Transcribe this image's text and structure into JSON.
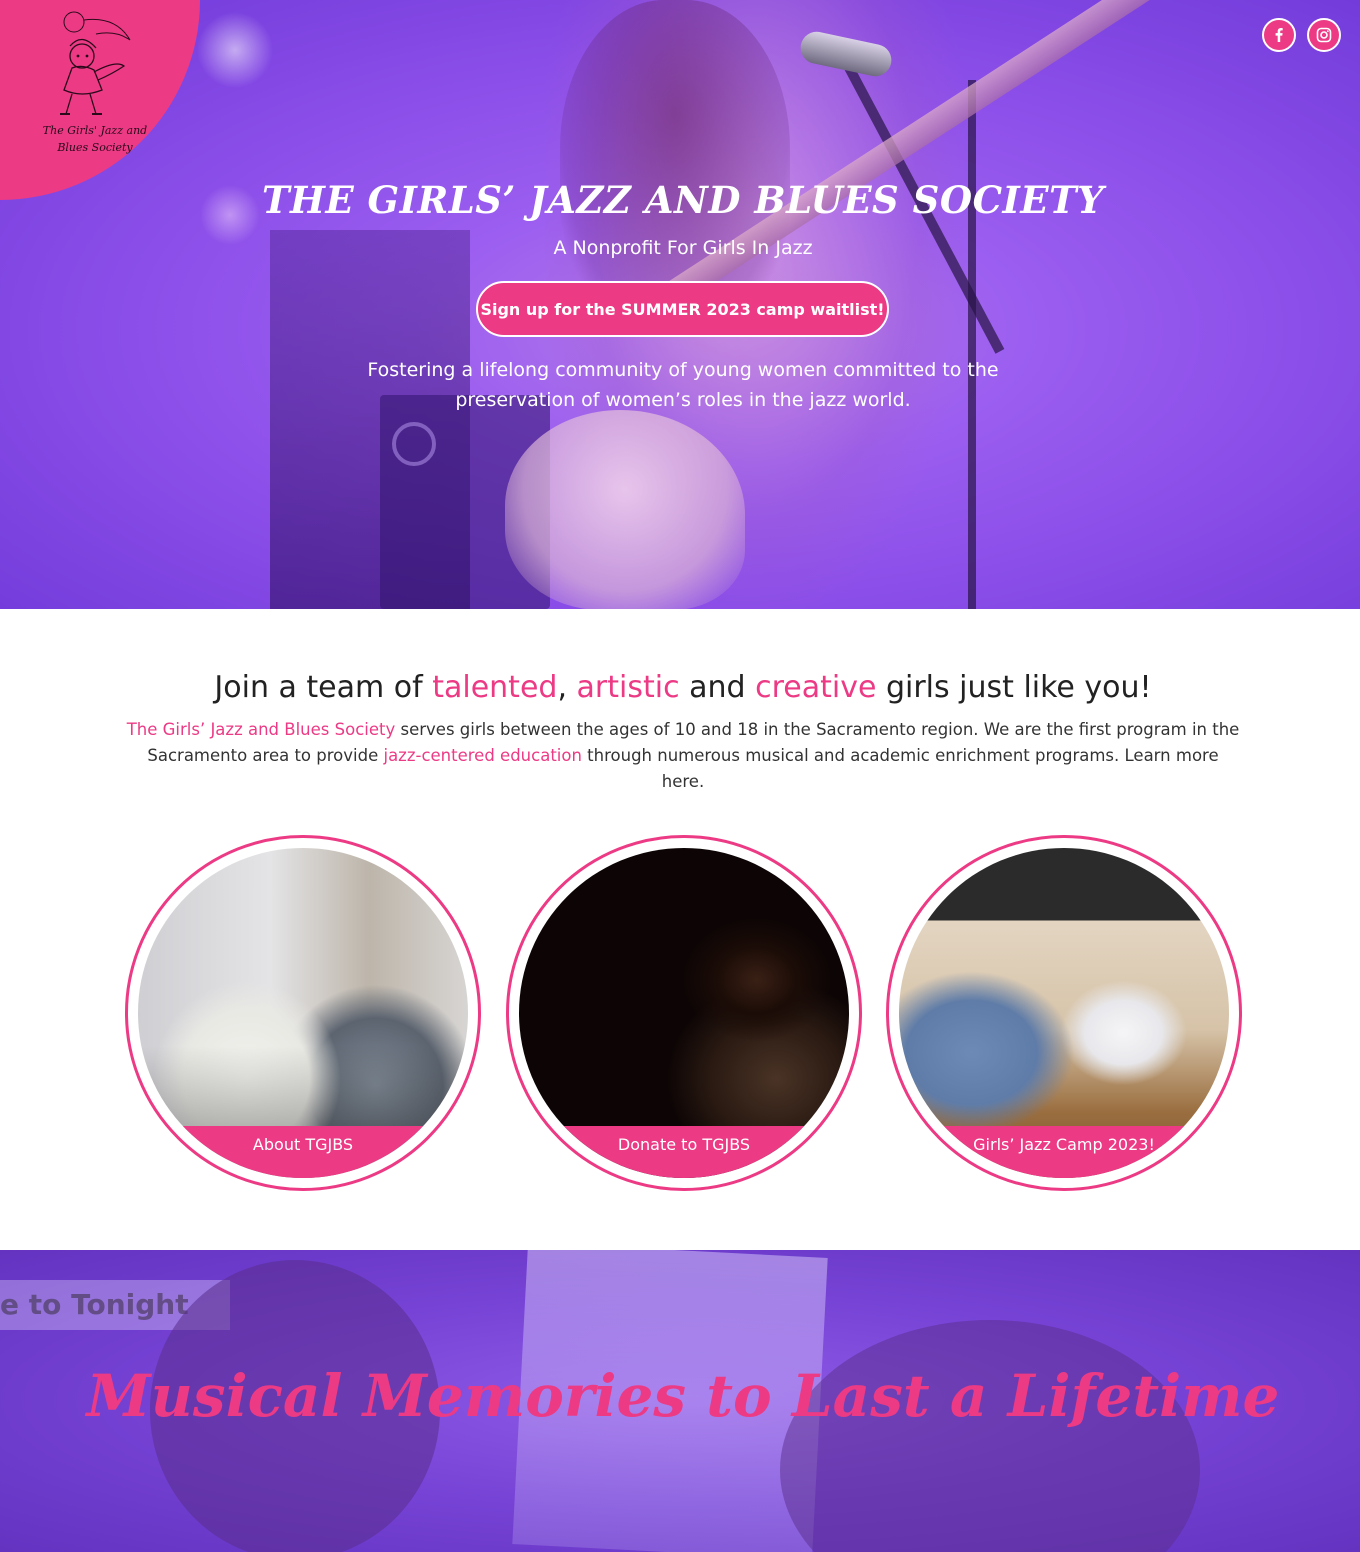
{
  "logo": {
    "text_line1": "The Girls' Jazz and",
    "text_line2": "Blues Society"
  },
  "social": {
    "facebook_icon": "facebook-icon",
    "instagram_icon": "instagram-icon"
  },
  "hero": {
    "title": "THE GIRLS’ JAZZ AND BLUES SOCIETY",
    "subtitle": "A Nonprofit For Girls In Jazz",
    "cta_label": "Sign up for the SUMMER 2023 camp waitlist!",
    "tagline": "Fostering a lifelong community of young women committed to the preservation of women’s roles in the jazz world."
  },
  "join": {
    "title_part1": "Join a team of ",
    "title_hl1": "talented",
    "title_sep1": ", ",
    "title_hl2": "artistic",
    "title_part2": " and ",
    "title_hl3": "creative",
    "title_part3": " girls just like you!",
    "body_link1": "The Girls’ Jazz and Blues Society",
    "body_part1": " serves girls between the ages of 10 and 18 in the Sacramento region. We are the first program in the Sacramento area to provide ",
    "body_link2": "jazz-centered education",
    "body_part2": " through numerous musical and academic enrichment programs. Learn more here."
  },
  "cards": [
    {
      "label": "About TGJBS"
    },
    {
      "label": "Donate to TGJBS"
    },
    {
      "label": "Girls’ Jazz Camp 2023!"
    }
  ],
  "banner": {
    "sign_text": "e to Tonight",
    "title": "Musical Memories to Last a Lifetime"
  },
  "colors": {
    "accent": "#ec3a85",
    "hero_purple": "#8a4de8"
  }
}
